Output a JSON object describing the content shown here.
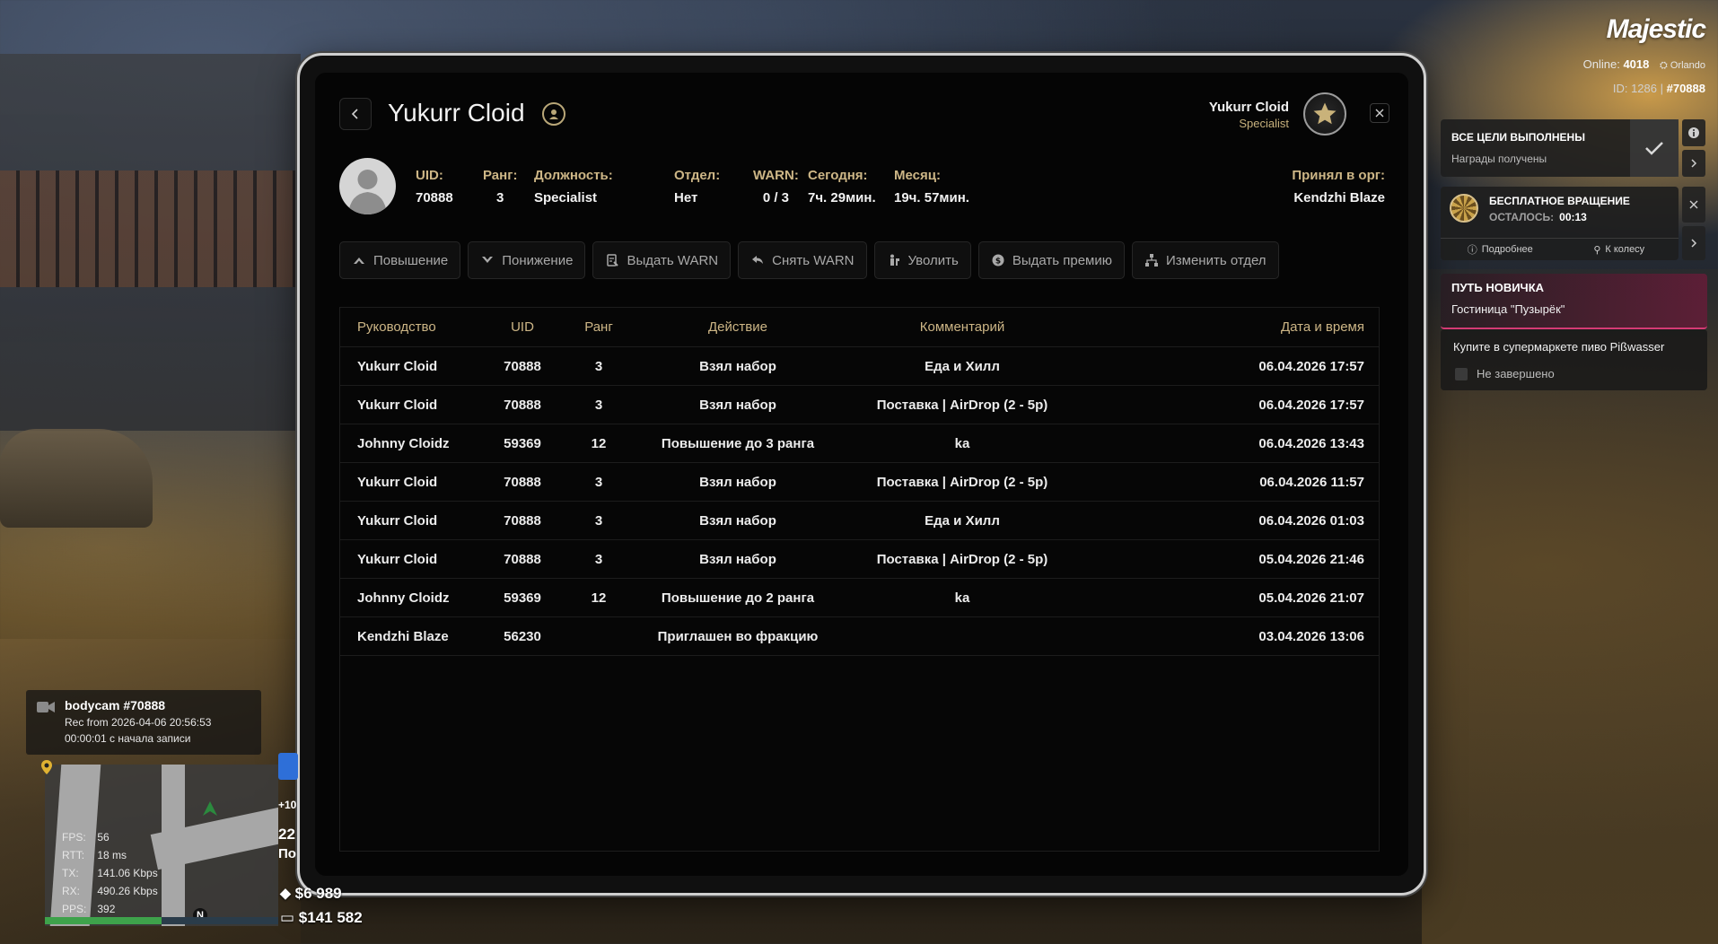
{
  "panel": {
    "title": "Yukurr Cloid",
    "header_user_name": "Yukurr Cloid",
    "header_user_role": "Specialist"
  },
  "info": {
    "uid_label": "UID:",
    "uid_value": "70888",
    "rank_label": "Ранг:",
    "rank_value": "3",
    "position_label": "Должность:",
    "position_value": "Specialist",
    "dept_label": "Отдел:",
    "dept_value": "Нет",
    "warn_label": "WARN:",
    "warn_value": "0 / 3",
    "today_label": "Сегодня:",
    "today_value": "7ч. 29мин.",
    "month_label": "Месяц:",
    "month_value": "19ч. 57мин.",
    "accepted_label": "Принял в орг:",
    "accepted_value": "Kendzhi Blaze"
  },
  "actions": [
    {
      "label": "Повышение",
      "icon": "chevron-up-icon"
    },
    {
      "label": "Понижение",
      "icon": "chevron-down-icon"
    },
    {
      "label": "Выдать WARN",
      "icon": "warn-doc-icon"
    },
    {
      "label": "Снять WARN",
      "icon": "undo-icon"
    },
    {
      "label": "Уволить",
      "icon": "fire-person-icon"
    },
    {
      "label": "Выдать премию",
      "icon": "coin-icon"
    },
    {
      "label": "Изменить отдел",
      "icon": "hierarchy-icon"
    }
  ],
  "table": {
    "headers": [
      "Руководство",
      "UID",
      "Ранг",
      "Действие",
      "Комментарий",
      "Дата и время"
    ],
    "rows": [
      [
        "Yukurr Cloid",
        "70888",
        "3",
        "Взял набор",
        "Еда и Хилл",
        "06.04.2026 17:57"
      ],
      [
        "Yukurr Cloid",
        "70888",
        "3",
        "Взял набор",
        "Поставка | AirDrop (2 - 5р)",
        "06.04.2026 17:57"
      ],
      [
        "Johnny Cloidz",
        "59369",
        "12",
        "Повышение до 3 ранга",
        "ka",
        "06.04.2026 13:43"
      ],
      [
        "Yukurr Cloid",
        "70888",
        "3",
        "Взял набор",
        "Поставка | AirDrop (2 - 5р)",
        "06.04.2026 11:57"
      ],
      [
        "Yukurr Cloid",
        "70888",
        "3",
        "Взял набор",
        "Еда и Хилл",
        "06.04.2026 01:03"
      ],
      [
        "Yukurr Cloid",
        "70888",
        "3",
        "Взял набор",
        "Поставка | AirDrop (2 - 5р)",
        "05.04.2026 21:46"
      ],
      [
        "Johnny Cloidz",
        "59369",
        "12",
        "Повышение до 2 ранга",
        "ka",
        "05.04.2026 21:07"
      ],
      [
        "Kendzhi Blaze",
        "56230",
        "",
        "Приглашен во фракцию",
        "",
        "03.04.2026 13:06"
      ]
    ]
  },
  "hud": {
    "logo": "Majestic",
    "online_label": "Online:",
    "online_value": "4018",
    "city": "Orlando",
    "id_label": "ID: 1286 |",
    "id_value": "#70888",
    "goal_title": "ВСЕ ЦЕЛИ ВЫПОЛНЕНЫ",
    "goal_sub": "Награды получены",
    "spin_title": "БЕСПЛАТНОЕ ВРАЩЕНИЕ",
    "spin_left_label": "ОСТАЛОСЬ:",
    "spin_left_value": "00:13",
    "spin_more": "Подробнее",
    "spin_wheel": "К колесу",
    "newbie_title": "ПУТЬ НОВИЧКА",
    "newbie_sub": "Гостиница \"Пузырёк\"",
    "task_text": "Купите в супермаркете пиво Pißwasser",
    "task_status": "Не завершено",
    "bodycam_title": "bodycam #70888",
    "bodycam_rec": "Rec from 2026-04-06 20:56:53",
    "bodycam_time": "00:00:01 с начала записи",
    "stats": [
      {
        "k": "FPS:",
        "v": "56"
      },
      {
        "k": "RTT:",
        "v": "18 ms"
      },
      {
        "k": "TX:",
        "v": "141.06 Kbps"
      },
      {
        "k": "RX:",
        "v": "490.26 Kbps"
      },
      {
        "k": "PPS:",
        "v": "392"
      }
    ],
    "side_plus": "+10",
    "side_num": "22",
    "side_text": "По",
    "money_cash": "$6 989",
    "money_bank": "$141 582",
    "compass": "N",
    "hp_fraction": 0.5
  }
}
